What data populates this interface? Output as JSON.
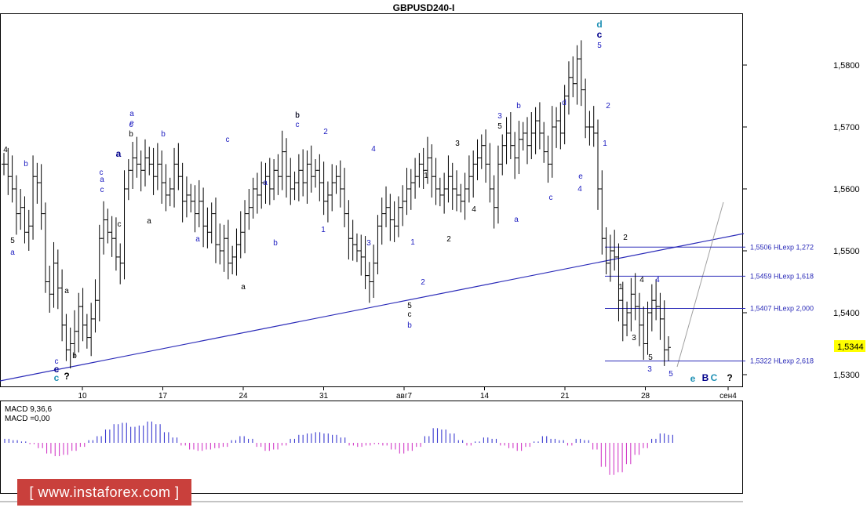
{
  "chart_data": {
    "type": "candlestick",
    "title": "GBPUSD240-I",
    "price_axis": {
      "min": 1.528,
      "max": 1.59,
      "ticks": [
        "1,5300",
        "1,5400",
        "1,5500",
        "1,5600",
        "1,5700",
        "1,5800"
      ]
    },
    "x_axis": {
      "ticks": [
        "10",
        "17",
        "24",
        "31",
        "авг7",
        "14",
        "21",
        "28",
        "сен4"
      ]
    },
    "current_price": "1,5344",
    "bars_anchor_prices": [
      1.564,
      1.562,
      1.56,
      1.556,
      1.557,
      1.553,
      1.554,
      1.562,
      1.561,
      1.556,
      1.545,
      1.543,
      1.548,
      1.544,
      1.538,
      1.534,
      1.535,
      1.537,
      1.541,
      1.538,
      1.536,
      1.539,
      1.542,
      1.552,
      1.555,
      1.553,
      1.552,
      1.549,
      1.548,
      1.56,
      1.563,
      1.565,
      1.564,
      1.563,
      1.565,
      1.564,
      1.562,
      1.564,
      1.561,
      1.559,
      1.56,
      1.564,
      1.562,
      1.558,
      1.559,
      1.558,
      1.556,
      1.558,
      1.554,
      1.553,
      1.556,
      1.551,
      1.55,
      1.552,
      1.548,
      1.549,
      1.551,
      1.553,
      1.556,
      1.557,
      1.56,
      1.559,
      1.561,
      1.562,
      1.56,
      1.563,
      1.562,
      1.566,
      1.562,
      1.56,
      1.561,
      1.563,
      1.561,
      1.564,
      1.562,
      1.563,
      1.561,
      1.558,
      1.559,
      1.561,
      1.562,
      1.56,
      1.556,
      1.552,
      1.551,
      1.55,
      1.549,
      1.546,
      1.545,
      1.548,
      1.554,
      1.556,
      1.557,
      1.555,
      1.554,
      1.557,
      1.558,
      1.56,
      1.561,
      1.562,
      1.564,
      1.563,
      1.565,
      1.562,
      1.56,
      1.559,
      1.56,
      1.562,
      1.56,
      1.559,
      1.558,
      1.56,
      1.562,
      1.564,
      1.565,
      1.567,
      1.564,
      1.56,
      1.557,
      1.564,
      1.567,
      1.569,
      1.567,
      1.565,
      1.568,
      1.569,
      1.567,
      1.569,
      1.571,
      1.569,
      1.566,
      1.564,
      1.57,
      1.571,
      1.569,
      1.575,
      1.578,
      1.577,
      1.581,
      1.576,
      1.57,
      1.57,
      1.569,
      1.56,
      1.552,
      1.548,
      1.55,
      1.549,
      1.542,
      1.538,
      1.54,
      1.543,
      1.541,
      1.538,
      1.535,
      1.54,
      1.542,
      1.541,
      1.539,
      1.534,
      1.5344
    ],
    "wave_labels": [
      {
        "t": "4",
        "c": "black"
      },
      {
        "t": "b",
        "c": "blue"
      },
      {
        "t": "a",
        "c": "blue"
      },
      {
        "t": "5",
        "c": "black"
      },
      {
        "t": "a",
        "c": "blue"
      },
      {
        "t": "c",
        "c": "blue"
      },
      {
        "t": "c",
        "c": "darkblue"
      },
      {
        "t": "c",
        "c": "teal"
      },
      {
        "t": "?",
        "c": "black"
      },
      {
        "t": "a",
        "c": "black"
      },
      {
        "t": "b",
        "c": "black"
      },
      {
        "t": "a",
        "c": "blue"
      },
      {
        "t": "c",
        "c": "blue"
      },
      {
        "t": "b",
        "c": "black"
      },
      {
        "t": "b",
        "c": "blue"
      },
      {
        "t": "a",
        "c": "darkblue"
      },
      {
        "t": "c",
        "c": "blue"
      },
      {
        "t": "c",
        "c": "black"
      },
      {
        "t": "a",
        "c": "black"
      },
      {
        "t": "a",
        "c": "blue"
      },
      {
        "t": "b",
        "c": "blue"
      },
      {
        "t": "c",
        "c": "blue"
      },
      {
        "t": "c",
        "c": "blue"
      },
      {
        "t": "e",
        "c": "blue"
      },
      {
        "t": "a",
        "c": "black"
      },
      {
        "t": "a",
        "c": "blue"
      },
      {
        "t": "b",
        "c": "blue"
      },
      {
        "t": "b",
        "c": "black"
      },
      {
        "t": "c",
        "c": "blue"
      },
      {
        "t": "2",
        "c": "blue"
      },
      {
        "t": "1",
        "c": "blue"
      },
      {
        "t": "4",
        "c": "blue"
      },
      {
        "t": "3",
        "c": "blue"
      },
      {
        "t": "1",
        "c": "blue"
      },
      {
        "t": "2",
        "c": "blue"
      },
      {
        "t": "5",
        "c": "black"
      },
      {
        "t": "c",
        "c": "black"
      },
      {
        "t": "b",
        "c": "blue"
      },
      {
        "t": "1",
        "c": "black"
      },
      {
        "t": "2",
        "c": "black"
      },
      {
        "t": "3",
        "c": "black"
      },
      {
        "t": "4",
        "c": "black"
      },
      {
        "t": "3",
        "c": "blue"
      },
      {
        "t": "5",
        "c": "black"
      },
      {
        "t": "b",
        "c": "blue"
      },
      {
        "t": "a",
        "c": "blue"
      },
      {
        "t": "c",
        "c": "blue"
      },
      {
        "t": "d",
        "c": "blue"
      },
      {
        "t": "e",
        "c": "blue"
      },
      {
        "t": "4",
        "c": "blue"
      },
      {
        "t": "d",
        "c": "teal"
      },
      {
        "t": "c",
        "c": "darkblue"
      },
      {
        "t": "5",
        "c": "blue"
      },
      {
        "t": "2",
        "c": "blue"
      },
      {
        "t": "1",
        "c": "blue"
      },
      {
        "t": "2",
        "c": "black"
      },
      {
        "t": "1",
        "c": "black"
      },
      {
        "t": "4",
        "c": "black"
      },
      {
        "t": "4",
        "c": "blue"
      },
      {
        "t": "3",
        "c": "black"
      },
      {
        "t": "5",
        "c": "black"
      },
      {
        "t": "3",
        "c": "blue"
      },
      {
        "t": "5",
        "c": "blue"
      },
      {
        "t": "e",
        "c": "teal"
      },
      {
        "t": "B",
        "c": "darkblue"
      },
      {
        "t": "C",
        "c": "teal"
      },
      {
        "t": "?",
        "c": "black"
      }
    ],
    "levels": [
      {
        "price": 1.5506,
        "label": "1,5506 HLexp 1,272"
      },
      {
        "price": 1.5459,
        "label": "1,5459 HLexp 1,618"
      },
      {
        "price": 1.5407,
        "label": "1,5407 HLexp 2,000"
      },
      {
        "price": 1.5322,
        "label": "1,5322 HLexp 2,618"
      }
    ],
    "macd": {
      "label_line1": "MACD 9,36,6",
      "label_line2": "MACD =0,00",
      "values": [
        0.3,
        0.2,
        0.1,
        -0.1,
        -0.4,
        -0.8,
        -1.0,
        -0.9,
        -0.6,
        -0.3,
        0.2,
        0.5,
        1.0,
        1.4,
        1.5,
        1.2,
        1.3,
        1.6,
        1.4,
        0.8,
        0.4,
        -0.2,
        -0.5,
        -0.6,
        -0.5,
        -0.4,
        -0.3,
        0.2,
        0.5,
        0.3,
        -0.3,
        -0.6,
        -0.5,
        -0.2,
        0.3,
        0.6,
        0.7,
        0.8,
        0.7,
        0.6,
        0.4,
        -0.2,
        -0.3,
        -0.2,
        -0.1,
        -0.2,
        -0.5,
        -0.8,
        -0.6,
        -0.3,
        0.5,
        1.1,
        1.0,
        0.7,
        0.2,
        -0.2,
        0.1,
        0.4,
        0.3,
        -0.2,
        -0.4,
        -0.6,
        -0.3,
        0.1,
        0.5,
        0.3,
        0.2,
        -0.2,
        0.3,
        0.2,
        -0.5,
        -1.8,
        -2.4,
        -2.2,
        -1.6,
        -0.9,
        -0.4,
        0.3,
        0.7,
        0.6
      ]
    }
  },
  "watermark": "[ www.instaforex.com ]",
  "colors": {
    "blue": "#1c1cc0",
    "darkblue": "#00008b",
    "teal": "#1e90b4",
    "black": "#000000",
    "macd_pos": "#3b3bd1",
    "macd_neg": "#d23cc8",
    "trend": "#2a2ab8",
    "price_bg": "#ffff00"
  }
}
